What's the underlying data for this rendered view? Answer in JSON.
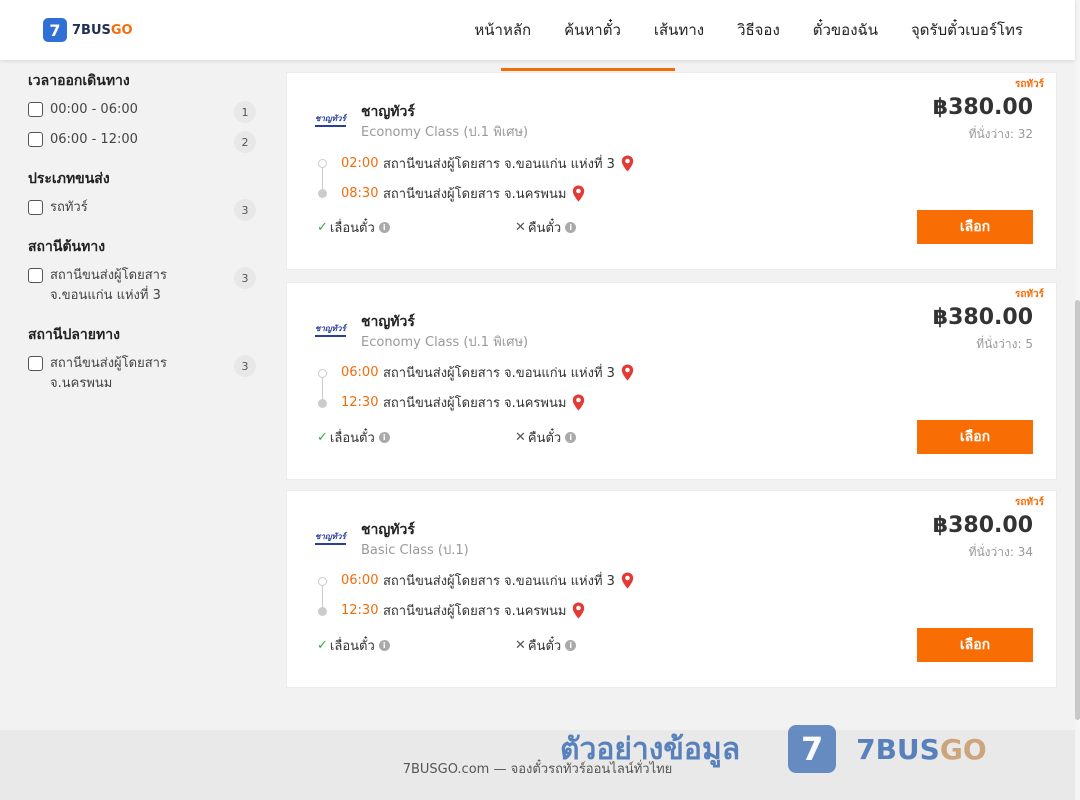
{
  "header": {
    "logo_mark": "7",
    "logo_text_main": "7BUS",
    "logo_text_accent": "GO",
    "nav": [
      "หน้าหลัก",
      "ค้นหาตั๋ว",
      "เส้นทาง",
      "วิธีจอง",
      "ตั๋วของฉัน",
      "จุดรับตั๋วเบอร์โทร"
    ]
  },
  "sidebar": {
    "groups": [
      {
        "title": "เวลาออกเดินทาง",
        "options": [
          {
            "label": "00:00 - 06:00",
            "count": "1"
          },
          {
            "label": "06:00 - 12:00",
            "count": "2"
          }
        ]
      },
      {
        "title": "ประเภทขนส่ง",
        "options": [
          {
            "label": "รถทัวร์",
            "count": "3"
          }
        ]
      },
      {
        "title": "สถานีต้นทาง",
        "options": [
          {
            "label": "สถานีขนส่งผู้โดยสาร จ.ขอนแก่น แห่งที่ 3",
            "count": "3"
          }
        ]
      },
      {
        "title": "สถานีปลายทาง",
        "options": [
          {
            "label": "สถานีขนส่งผู้โดยสาร จ.นครพนม",
            "count": "3"
          }
        ]
      }
    ]
  },
  "trips": [
    {
      "badge": "รถทัวร์",
      "operator_logo": "ชาญทัวร์",
      "operator": "ชาญทัวร์",
      "class": "Economy Class (ป.1 พิเศษ)",
      "price": "฿380.00",
      "seats": "ที่นั่งว่าง: 32",
      "dep_time": "02:00",
      "dep_station": "สถานีขนส่งผู้โดยสาร จ.ขอนแก่น แห่งที่ 3",
      "arr_time": "08:30",
      "arr_station": "สถานีขนส่งผู้โดยสาร จ.นครพนม",
      "reschedule": "เลื่อนตั๋ว",
      "refund": "คืนตั๋ว",
      "select": "เลือก"
    },
    {
      "badge": "รถทัวร์",
      "operator_logo": "ชาญทัวร์",
      "operator": "ชาญทัวร์",
      "class": "Economy Class (ป.1 พิเศษ)",
      "price": "฿380.00",
      "seats": "ที่นั่งว่าง: 5",
      "dep_time": "06:00",
      "dep_station": "สถานีขนส่งผู้โดยสาร จ.ขอนแก่น แห่งที่ 3",
      "arr_time": "12:30",
      "arr_station": "สถานีขนส่งผู้โดยสาร จ.นครพนม",
      "reschedule": "เลื่อนตั๋ว",
      "refund": "คืนตั๋ว",
      "select": "เลือก"
    },
    {
      "badge": "รถทัวร์",
      "operator_logo": "ชาญทัวร์",
      "operator": "ชาญทัวร์",
      "class": "Basic Class (ป.1)",
      "price": "฿380.00",
      "seats": "ที่นั่งว่าง: 34",
      "dep_time": "06:00",
      "dep_station": "สถานีขนส่งผู้โดยสาร จ.ขอนแก่น แห่งที่ 3",
      "arr_time": "12:30",
      "arr_station": "สถานีขนส่งผู้โดยสาร จ.นครพนม",
      "reschedule": "เลื่อนตั๋ว",
      "refund": "คืนตั๋ว",
      "select": "เลือก"
    }
  ],
  "footer": {
    "text": "7BUSGO.com — จองตั๋วรถทัวร์ออนไลน์ทั่วไทย"
  },
  "watermark": {
    "text": "ตัวอย่างข้อมูล",
    "logo_mark": "7",
    "brand_main": "7BUS",
    "brand_accent": "GO"
  },
  "colors": {
    "accent": "#f96d05",
    "check": "#2eaa3a",
    "pin": "#e53935"
  }
}
